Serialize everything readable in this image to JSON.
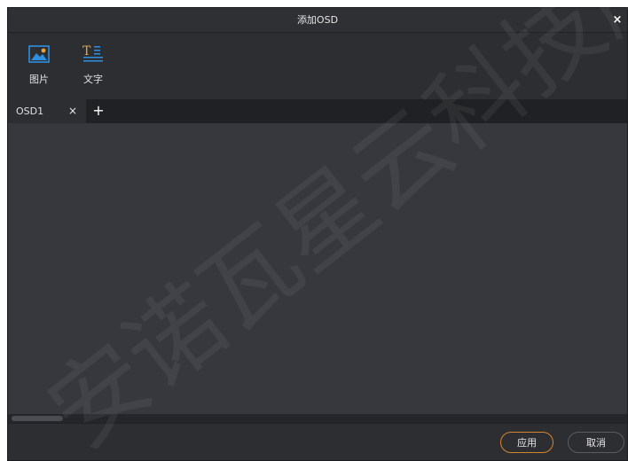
{
  "dialog": {
    "title": "添加OSD",
    "close_symbol": "×"
  },
  "toolbar": {
    "items": [
      {
        "label": "图片",
        "icon": "image-icon"
      },
      {
        "label": "文字",
        "icon": "text-icon"
      }
    ]
  },
  "tabs": {
    "items": [
      {
        "label": "OSD1",
        "close_symbol": "×"
      }
    ],
    "add_symbol": "+"
  },
  "footer": {
    "apply_label": "应用",
    "cancel_label": "取消"
  },
  "watermark": {
    "text": "安诺瓦星云科技股"
  },
  "colors": {
    "dialog_bg": "#2d2e32",
    "content_bg": "#37383d",
    "tabbar_bg": "#202124",
    "accent_orange": "#d6852e",
    "icon_blue": "#2f8fe0",
    "icon_gold": "#e8a33a"
  }
}
